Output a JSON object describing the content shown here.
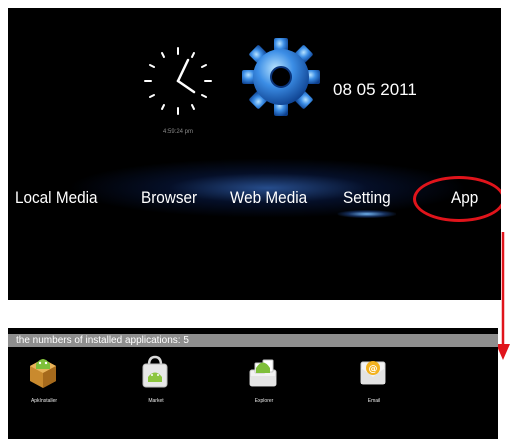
{
  "home": {
    "clock_time": "4:59:24 pm",
    "date": "08 05 2011",
    "menu": [
      {
        "label": "Local Media"
      },
      {
        "label": "Browser"
      },
      {
        "label": "Web Media"
      },
      {
        "label": "Setting"
      },
      {
        "label": "App"
      }
    ],
    "active_item": "Setting",
    "highlighted_item": "App"
  },
  "apps_screen": {
    "header": "the numbers of installed applications: 5",
    "apps": [
      {
        "label": "ApkInstaller",
        "icon": "apk-installer-icon"
      },
      {
        "label": "Market",
        "icon": "market-icon"
      },
      {
        "label": "Explorer",
        "icon": "explorer-icon"
      },
      {
        "label": "Email",
        "icon": "email-icon"
      }
    ]
  },
  "colors": {
    "highlight": "#e0141b",
    "background": "#000000",
    "header_bar": "#8e8e8e",
    "glow": "#4a8cff"
  }
}
